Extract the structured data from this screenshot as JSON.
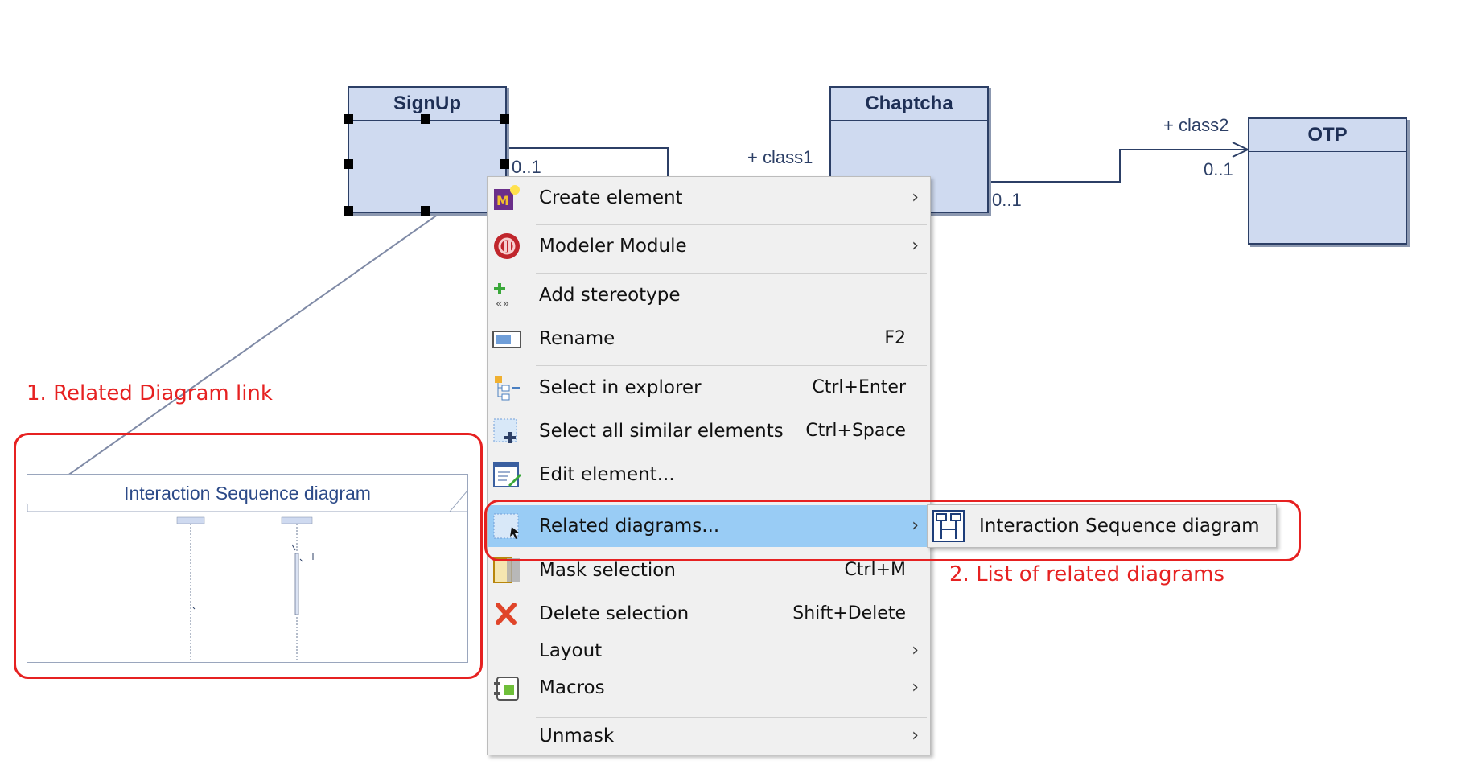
{
  "diagram": {
    "classes": {
      "signup": "SignUp",
      "chaptcha": "Chaptcha",
      "otp": "OTP"
    },
    "labels": {
      "mult_signup": "0..1",
      "role_class1": "+ class1",
      "mult_chaptcha": "0..1",
      "role_class2": "+ class2",
      "mult_otp": "0..1"
    },
    "related_thumbnail_title": "Interaction Sequence diagram"
  },
  "annotations": {
    "related_link": "1. Related Diagram link",
    "related_list": "2. List of related diagrams"
  },
  "context_menu": {
    "items": [
      {
        "label": "Create element",
        "shortcut": "",
        "submenu": true,
        "icon": "create-element-icon"
      },
      {
        "label": "Modeler Module",
        "shortcut": "",
        "submenu": true,
        "icon": "modeler-module-icon"
      },
      {
        "label": "Add stereotype",
        "shortcut": "",
        "submenu": false,
        "icon": "add-stereotype-icon"
      },
      {
        "label": "Rename",
        "shortcut": "F2",
        "submenu": false,
        "icon": "rename-icon"
      },
      {
        "label": "Select in explorer",
        "shortcut": "Ctrl+Enter",
        "submenu": false,
        "icon": "select-in-explorer-icon"
      },
      {
        "label": "Select all similar elements",
        "shortcut": "Ctrl+Space",
        "submenu": false,
        "icon": "select-similar-icon"
      },
      {
        "label": "Edit element...",
        "shortcut": "",
        "submenu": false,
        "icon": "edit-element-icon"
      },
      {
        "label": "Related diagrams...",
        "shortcut": "",
        "submenu": true,
        "icon": "related-diagrams-icon",
        "selected": true
      },
      {
        "label": "Mask selection",
        "shortcut": "Ctrl+M",
        "submenu": false,
        "icon": "mask-selection-icon"
      },
      {
        "label": "Delete selection",
        "shortcut": "Shift+Delete",
        "submenu": false,
        "icon": "delete-icon"
      },
      {
        "label": "Layout",
        "shortcut": "",
        "submenu": true,
        "icon": ""
      },
      {
        "label": "Macros",
        "shortcut": "",
        "submenu": true,
        "icon": "macros-icon"
      },
      {
        "label": "Unmask",
        "shortcut": "",
        "submenu": true,
        "icon": ""
      }
    ],
    "submenu_arrow": "›"
  },
  "related_submenu": {
    "items": [
      {
        "label": "Interaction Sequence diagram",
        "icon": "sequence-diagram-icon"
      }
    ]
  },
  "colors": {
    "annotation_red": "#e62121",
    "class_fill": "#cfdaf0",
    "class_border": "#2c3f66",
    "menu_highlight": "#99ccf5"
  }
}
